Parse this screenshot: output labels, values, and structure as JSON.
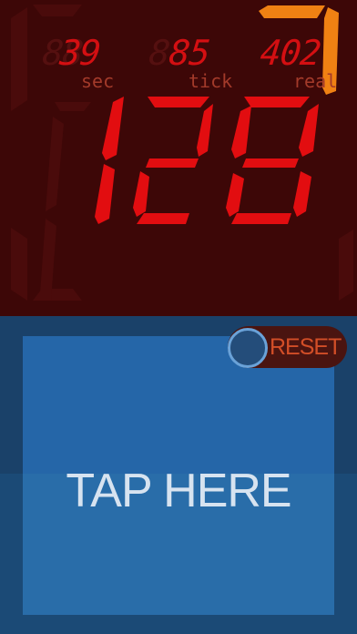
{
  "display": {
    "stats": [
      {
        "value": "39",
        "label": "sec"
      },
      {
        "value": "85",
        "label": "tick"
      },
      {
        "value": "402",
        "label": "real"
      }
    ],
    "main_count": "128",
    "colors": {
      "digit": "#e20d10",
      "background": "#3d0707",
      "accent": "#f08113"
    }
  },
  "pad": {
    "tap_label": "TAP HERE",
    "reset_label": "RESET",
    "colors": {
      "pad": "#2566a8",
      "background": "#1a4169"
    }
  },
  "icons": {
    "corner": "orange-corner-indicator"
  }
}
